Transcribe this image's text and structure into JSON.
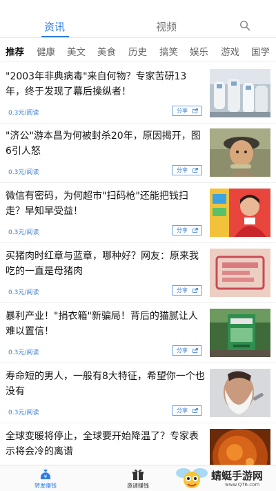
{
  "top_tabs": {
    "news": "资讯",
    "video": "视频"
  },
  "categories": [
    "推荐",
    "健康",
    "美文",
    "美食",
    "历史",
    "搞笑",
    "娱乐",
    "游戏",
    "国学"
  ],
  "articles": [
    {
      "title": "\"2003年非典病毒\"来自何物？专家苦研13年，终于发现了幕后操纵者！",
      "meta": "0.3元/阅读",
      "share": "分享",
      "thumb": "sars-workers-photo"
    },
    {
      "title": "\"济公\"游本昌为何被封杀20年，原因揭开，图6引人怒",
      "meta": "0.3元/阅读",
      "share": "分享",
      "thumb": "actor-portrait-photo"
    },
    {
      "title": "微信有密码，为何超市\"扫码枪\"还能把钱扫走？早知早受益！",
      "meta": "0.3元/阅读",
      "share": "分享",
      "thumb": "cashier-photo"
    },
    {
      "title": "买猪肉时红章与蓝章，哪种好？网友：原来我吃的一直是母猪肉",
      "meta": "0.3元/阅读",
      "share": "分享",
      "thumb": "pork-stamp-photo"
    },
    {
      "title": "暴利产业！\"捐衣箱\"新骗局！背后的猫腻让人难以置信！",
      "meta": "0.3元/阅读",
      "share": "分享",
      "thumb": "donation-box-photo"
    },
    {
      "title": "寿命短的男人，一般有8大特征，希望你一个也没有",
      "meta": "0.3元/阅读",
      "share": "分享",
      "thumb": "shaving-man-photo"
    },
    {
      "title": "全球变暖将停止，全球要开始降温了？专家表示将会冷的离谱",
      "meta": "",
      "share": "",
      "thumb": "sun-surface-photo"
    }
  ],
  "bottom_nav": [
    {
      "label": "转发赚钱",
      "icon": "money-bag-icon",
      "active": true
    },
    {
      "label": "邀请赚钱",
      "icon": "gift-icon",
      "active": false
    }
  ],
  "watermark": {
    "brand": "蜻蜓手游网",
    "url": "www.QT6.com"
  },
  "colors": {
    "accent": "#2b7de9",
    "text": "#141414",
    "muted": "#666666"
  }
}
